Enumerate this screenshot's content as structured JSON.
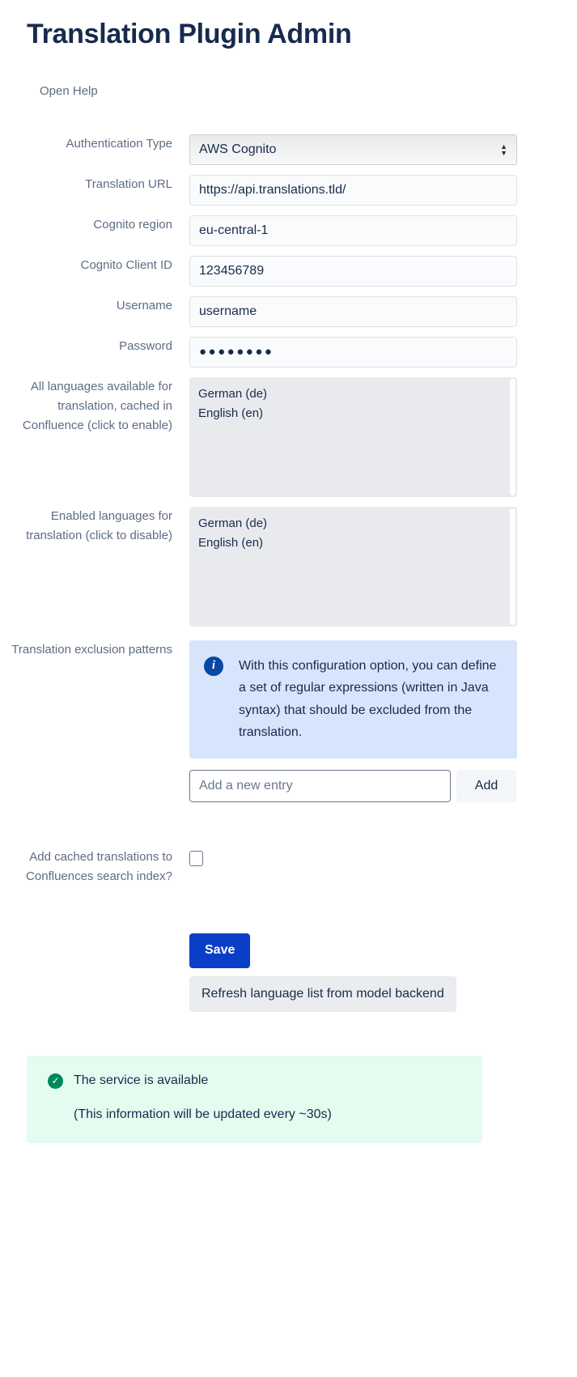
{
  "header": {
    "title": "Translation Plugin Admin",
    "help_link": "Open Help"
  },
  "form": {
    "auth_type": {
      "label": "Authentication Type",
      "value": "AWS Cognito",
      "options": [
        "AWS Cognito"
      ]
    },
    "translation_url": {
      "label": "Translation URL",
      "value": "https://api.translations.tld/"
    },
    "cognito_region": {
      "label": "Cognito region",
      "value": "eu-central-1"
    },
    "cognito_client_id": {
      "label": "Cognito Client ID",
      "value": "123456789"
    },
    "username": {
      "label": "Username",
      "value": "username"
    },
    "password": {
      "label": "Password",
      "value": "●●●●●●●●"
    },
    "all_languages": {
      "label": "All languages available for translation, cached in Confluence (click to enable)",
      "items": [
        "German (de)",
        "English (en)"
      ]
    },
    "enabled_languages": {
      "label": "Enabled languages for translation (click to disable)",
      "items": [
        "German (de)",
        "English (en)"
      ]
    },
    "exclusion_patterns": {
      "label": "Translation exclusion patterns",
      "info_icon": "info-icon",
      "info_text": "With this configuration option, you can define a set of regular expressions (written in Java syntax) that should be excluded from the translation.",
      "entry_placeholder": "Add a new entry",
      "entry_value": "",
      "add_label": "Add"
    },
    "search_index": {
      "label": "Add cached translations to Confluences search index?",
      "checked": false
    }
  },
  "actions": {
    "save_label": "Save",
    "refresh_label": "Refresh language list from model backend"
  },
  "status": {
    "icon": "check-circle-icon",
    "message": "The service is available",
    "note": "(This information will be updated every ~30s)"
  },
  "colors": {
    "accent": "#0a3ec8",
    "info_bg": "#d7e4fb",
    "success_bg": "#e3fcef",
    "success_icon": "#00875a",
    "label_text": "#5e6c84"
  }
}
